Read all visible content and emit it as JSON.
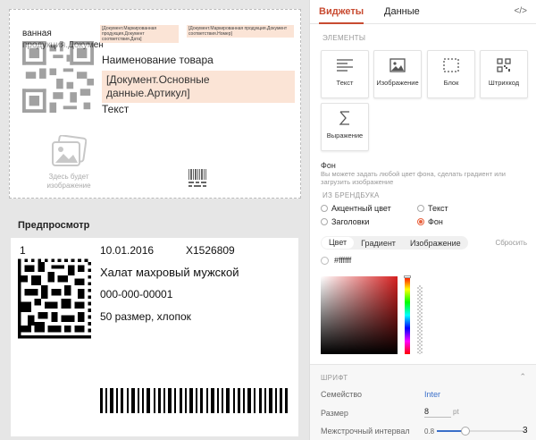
{
  "editor": {
    "cut_text": "ванная продукция.Докумен",
    "tag1": "[Документ.Маркированная продукция.Документ соответствия.Дата]",
    "tag2": "[Документ.Маркированная продукция.Документ соответствия.Номер]",
    "name_label": "Наименование товара",
    "article_tag": "[Документ.Основные данные.Артикул]",
    "text_label": "Текст",
    "image_placeholder": "Здесь будет изображение"
  },
  "preview": {
    "title": "Предпросмотр",
    "number": "1",
    "date": "10.01.2016",
    "article": "X1526809",
    "product": "Халат махровый мужской",
    "code": "000-000-00001",
    "size": "50 размер, хлопок"
  },
  "panel": {
    "tabs": [
      "Виджеты",
      "Данные"
    ],
    "code_toggle": "</>",
    "elements_label": "ЭЛЕМЕНТЫ",
    "widgets": [
      "Текст",
      "Изображение",
      "Блок",
      "Штрихкод",
      "Выражение"
    ],
    "background_title": "Фон",
    "background_desc": "Вы можете задать любой цвет фона, сделать градиент или загрузить изображение",
    "brandbook_label": "ИЗ БРЕНДБУКА",
    "options": [
      "Акцентный цвет",
      "Текст",
      "Заголовки",
      "Фон"
    ],
    "selected_option": "Фон",
    "color_tabs": [
      "Цвет",
      "Градиент",
      "Изображение"
    ],
    "reset": "Сбросить",
    "hex": "#ffffff",
    "font_label": "ШРИФТ",
    "family_label": "Семейство",
    "family_value": "Inter",
    "size_label": "Размер",
    "size_value": "8",
    "size_unit": "pt",
    "spacing_label": "Межстрочный интервал",
    "spacing_min": "0.8",
    "spacing_max": "3"
  },
  "colors": {
    "accent": "#c84b31",
    "tag_bg": "#fbe4d6",
    "link": "#3a6fc9"
  }
}
